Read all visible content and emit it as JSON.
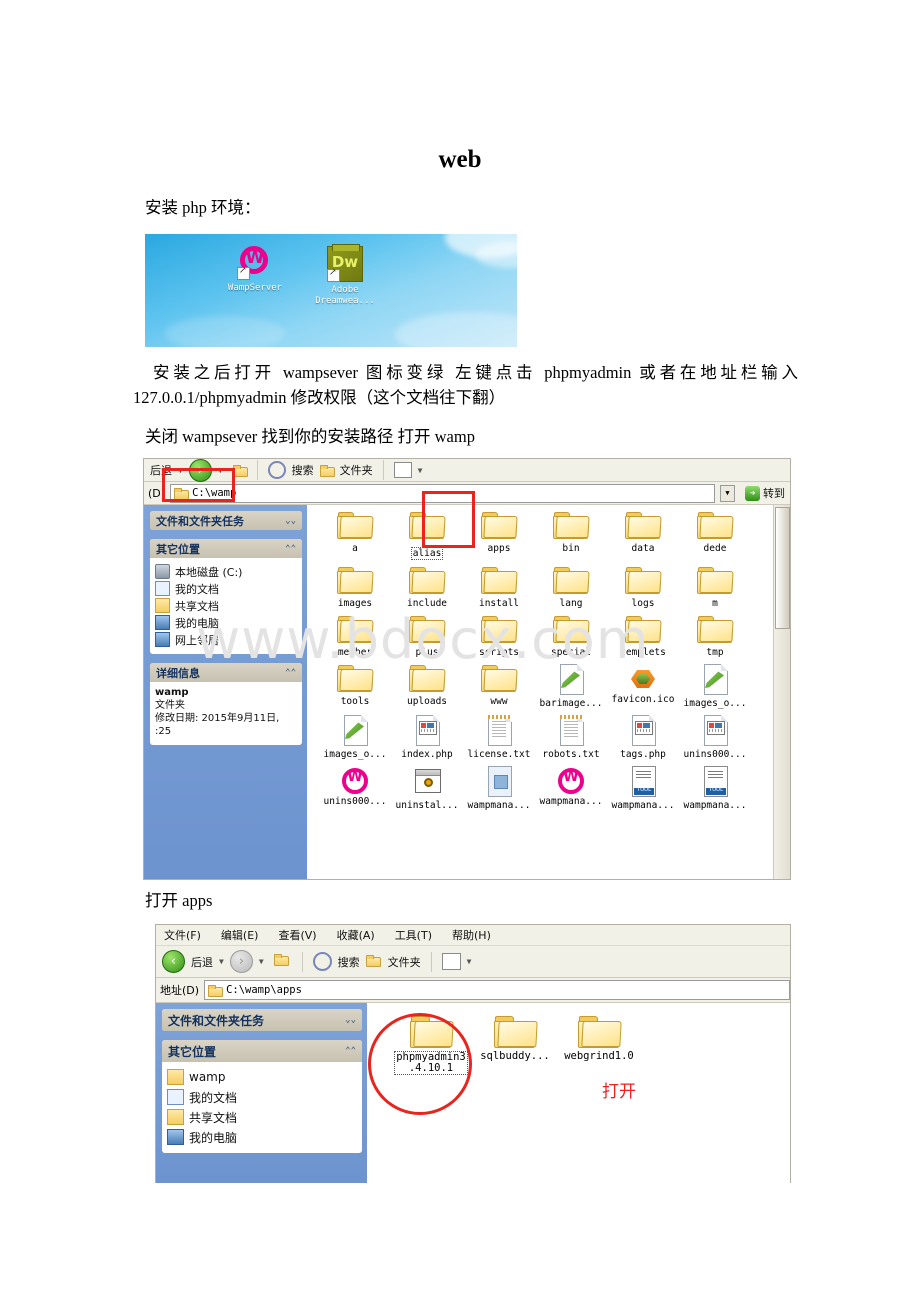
{
  "document": {
    "title": "web",
    "paragraphs": {
      "p1": "安装 php 环境：",
      "p2": "安装之后打开 wampsever 图标变绿 左键点击 phpmyadmin 或者在地址栏输入 127.0.0.1/phpmyadmin 修改权限（这个文档往下翻）",
      "p3": "关闭 wampsever 找到你的安装路径 打开 wamp",
      "p4": "打开 apps"
    },
    "watermark": "www.bdocx.com"
  },
  "desktop_screenshot": {
    "icons": [
      {
        "label": "WampServer",
        "icon": "wampserver-icon"
      },
      {
        "label": "Adobe\nDreamwea...",
        "label_line1": "Adobe",
        "label_line2": "Dreamwea...",
        "icon": "dreamweaver-icon"
      }
    ]
  },
  "explorer_wamp": {
    "toolbar": {
      "back_label": "后退",
      "search_label": "搜索",
      "folders_label": "文件夹",
      "views_label": "views"
    },
    "address": {
      "label": "(D)",
      "value": "C:\\wamp",
      "go_label": "转到"
    },
    "sidebar": {
      "panels": [
        {
          "title": "文件和文件夹任务",
          "collapsed": true,
          "items": []
        },
        {
          "title": "其它位置",
          "collapsed": false,
          "items": [
            {
              "label": "本地磁盘 (C:)",
              "icon": "drive-icon"
            },
            {
              "label": "我的文档",
              "icon": "document-icon"
            },
            {
              "label": "共享文档",
              "icon": "shared-folder-icon"
            },
            {
              "label": "我的电脑",
              "icon": "computer-icon"
            },
            {
              "label": "网上邻居",
              "icon": "network-icon"
            }
          ]
        },
        {
          "title": "详细信息",
          "collapsed": false,
          "detail_lines": [
            "wamp",
            "文件夹",
            "修改日期: 2015年9月11日,",
            ":25"
          ]
        }
      ]
    },
    "items": [
      {
        "name": "a",
        "type": "folder"
      },
      {
        "name": "alias",
        "type": "folder",
        "selected": true
      },
      {
        "name": "apps",
        "type": "folder",
        "highlighted": true
      },
      {
        "name": "bin",
        "type": "folder"
      },
      {
        "name": "data",
        "type": "folder"
      },
      {
        "name": "dede",
        "type": "folder"
      },
      {
        "name": "images",
        "type": "folder"
      },
      {
        "name": "include",
        "type": "folder"
      },
      {
        "name": "install",
        "type": "folder"
      },
      {
        "name": "lang",
        "type": "folder"
      },
      {
        "name": "logs",
        "type": "folder"
      },
      {
        "name": "m",
        "type": "folder"
      },
      {
        "name": "member",
        "type": "folder"
      },
      {
        "name": "plus",
        "type": "folder"
      },
      {
        "name": "scripts",
        "type": "folder"
      },
      {
        "name": "special",
        "type": "folder"
      },
      {
        "name": "templets",
        "type": "folder"
      },
      {
        "name": "tmp",
        "type": "folder"
      },
      {
        "name": "tools",
        "type": "folder"
      },
      {
        "name": "uploads",
        "type": "folder"
      },
      {
        "name": "www",
        "type": "folder"
      },
      {
        "name": "barimage...",
        "type": "pen-file"
      },
      {
        "name": "favicon.ico",
        "type": "ico-file"
      },
      {
        "name": "images_o...",
        "type": "pen-file"
      },
      {
        "name": "images_o...",
        "type": "pen-file"
      },
      {
        "name": "index.php",
        "type": "php-file"
      },
      {
        "name": "license.txt",
        "type": "txt-file"
      },
      {
        "name": "robots.txt",
        "type": "txt-file"
      },
      {
        "name": "tags.php",
        "type": "php-file"
      },
      {
        "name": "unins000...",
        "type": "php-file"
      },
      {
        "name": "unins000...",
        "type": "wamp-file"
      },
      {
        "name": "uninstal...",
        "type": "gear-file"
      },
      {
        "name": "wampmana...",
        "type": "blue-file"
      },
      {
        "name": "wampmana...",
        "type": "wamp-file"
      },
      {
        "name": "wampmana...",
        "type": "tool-file"
      },
      {
        "name": "wampmana...",
        "type": "tool-file"
      }
    ]
  },
  "explorer_apps": {
    "menubar": [
      "文件(F)",
      "编辑(E)",
      "查看(V)",
      "收藏(A)",
      "工具(T)",
      "帮助(H)"
    ],
    "toolbar": {
      "back_label": "后退",
      "search_label": "搜索",
      "folders_label": "文件夹"
    },
    "address": {
      "label": "地址(D)",
      "value": "C:\\wamp\\apps"
    },
    "sidebar": {
      "panels": [
        {
          "title": "文件和文件夹任务",
          "collapsed": true
        },
        {
          "title": "其它位置",
          "collapsed": false,
          "items": [
            {
              "label": "wamp",
              "icon": "folder-icon"
            },
            {
              "label": "我的文档",
              "icon": "document-icon"
            },
            {
              "label": "共享文档",
              "icon": "shared-folder-icon"
            },
            {
              "label": "我的电脑",
              "icon": "computer-icon"
            }
          ]
        }
      ]
    },
    "items": [
      {
        "name": "phpmyadmin3",
        "name_line2": ".4.10.1",
        "type": "folder",
        "selected": true,
        "circled": true
      },
      {
        "name": "sqlbuddy...",
        "type": "folder"
      },
      {
        "name": "webgrind1.0",
        "type": "folder"
      }
    ],
    "annotation": "打开"
  },
  "colors": {
    "annotation_red": "#e8241c",
    "sidebar_blue": "#7ba0d6",
    "wamp_pink": "#ec008c"
  }
}
